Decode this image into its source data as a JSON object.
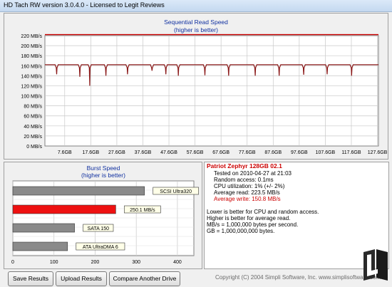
{
  "window": {
    "title": "HD Tach RW version 3.0.4.0 - Licensed to Legit Reviews"
  },
  "seq": {
    "title": "Sequential Read Speed",
    "subtitle": "(higher is better)",
    "y_labels": [
      "220 MB/s",
      "200 MB/s",
      "180 MB/s",
      "160 MB/s",
      "140 MB/s",
      "120 MB/s",
      "100 MB/s",
      "80 MB/s",
      "60 MB/s",
      "40 MB/s",
      "20 MB/s",
      "0 MB/s"
    ],
    "x_labels": [
      "7.6GB",
      "17.6GB",
      "27.6GB",
      "37.6GB",
      "47.6GB",
      "57.6GB",
      "67.6GB",
      "77.6GB",
      "87.6GB",
      "97.6GB",
      "107.6GB",
      "117.6GB",
      "127.6GB"
    ]
  },
  "burst": {
    "title": "Burst Speed",
    "subtitle": "(higher is better)",
    "axis_labels": [
      "0",
      "100",
      "200",
      "300",
      "400"
    ],
    "bars": [
      {
        "label": "SCSI Ultra320",
        "value": 320,
        "highlight": false
      },
      {
        "label": "250.1 MB/s",
        "value": 250.1,
        "highlight": true
      },
      {
        "label": "SATA 150",
        "value": 150,
        "highlight": false
      },
      {
        "label": "ATA UltraDMA 6",
        "value": 133,
        "highlight": false
      }
    ]
  },
  "info": {
    "drive": "Patriot Zephyr 128GB 02.1",
    "tested": "Tested on 2010-04-27 at 21:03",
    "random_access": "Random access: 0.1ms",
    "cpu": "CPU utilization: 1% (+/- 2%)",
    "avg_read": "Average read: 223.5 MB/s",
    "avg_write": "Average write: 150.8 MB/s",
    "note1": "Lower is better for CPU and random access.",
    "note2": "Higher is better for average read.",
    "note3": "MB/s = 1,000,000 bytes per second.",
    "note4": "GB = 1,000,000,000 bytes."
  },
  "buttons": {
    "save": "Save Results",
    "upload": "Upload Results",
    "compare": "Compare Another Drive"
  },
  "footer": {
    "copyright": "Copyright (C) 2004 Simpli Software, Inc. www.simplisoftware.com"
  },
  "logo": {
    "text": "LEGIT REVIEWS"
  },
  "chart_data": [
    {
      "type": "line",
      "title": "Sequential Read Speed",
      "subtitle": "(higher is better)",
      "xlabel": "",
      "ylabel": "",
      "ylim": [
        0,
        220
      ],
      "y_unit": "MB/s",
      "x_ticks": [
        "7.6GB",
        "17.6GB",
        "27.6GB",
        "37.6GB",
        "47.6GB",
        "57.6GB",
        "67.6GB",
        "77.6GB",
        "87.6GB",
        "97.6GB",
        "107.6GB",
        "117.6GB",
        "127.6GB"
      ],
      "series": [
        {
          "name": "Read",
          "color": "#8b1a1a",
          "baseline_mb_s": 162,
          "dips_gb": [
            [
              4.5,
              143
            ],
            [
              13.4,
              138
            ],
            [
              17.2,
              120
            ],
            [
              23.4,
              140
            ],
            [
              31.7,
              143
            ],
            [
              41.1,
              150
            ],
            [
              46.4,
              143
            ],
            [
              51.2,
              140
            ],
            [
              61.4,
              141
            ],
            [
              70.5,
              140
            ],
            [
              80.7,
              140
            ],
            [
              89.9,
              140
            ],
            [
              99.3,
              142
            ],
            [
              108.3,
              143
            ],
            [
              117.7,
              140
            ]
          ]
        },
        {
          "name": "Write",
          "color": "#cc0000",
          "constant_mb_s": 222
        }
      ],
      "grid": true
    },
    {
      "type": "bar",
      "title": "Burst Speed",
      "subtitle": "(higher is better)",
      "categories": [
        "SCSI Ultra320",
        "250.1 MB/s",
        "SATA 150",
        "ATA UltraDMA 6"
      ],
      "values": [
        320,
        250.1,
        150,
        133
      ],
      "xlim": [
        0,
        440
      ],
      "grid": true
    }
  ]
}
